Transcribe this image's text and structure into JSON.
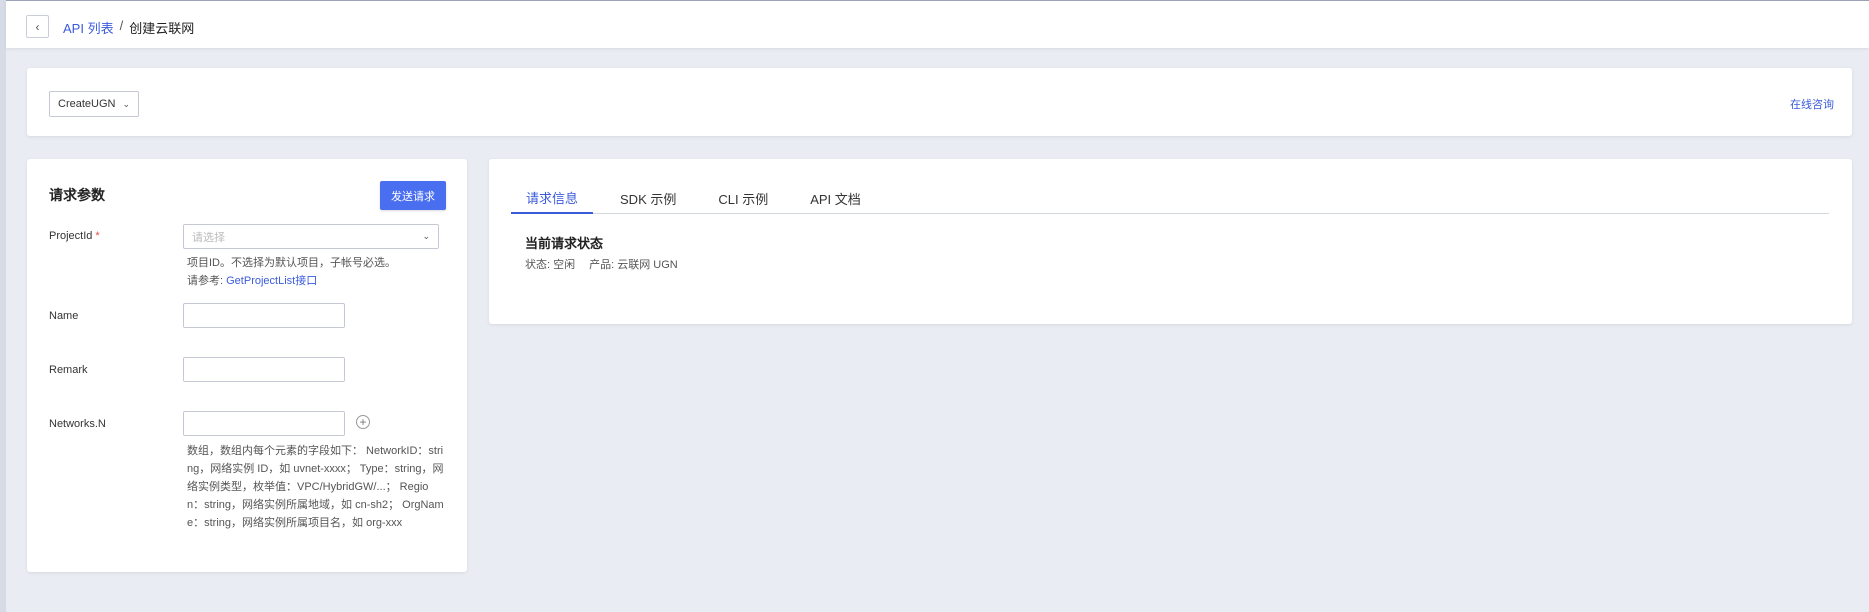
{
  "breadcrumb": {
    "back_icon": "chevron-left-icon",
    "parent": "API 列表",
    "separator": "/",
    "current": "创建云联网"
  },
  "action_bar": {
    "selected_action": "CreateUGN",
    "online_consult": "在线咨询"
  },
  "params": {
    "title": "请求参数",
    "send_button": "发送请求",
    "project_id": {
      "label": "ProjectId",
      "required_mark": "*",
      "placeholder": "请选择",
      "help_line1": "项目ID。不选择为默认项目，子帐号必选。",
      "help_line2_prefix": "请参考:",
      "help_link": "GetProjectList接口"
    },
    "name": {
      "label": "Name",
      "value": ""
    },
    "remark": {
      "label": "Remark",
      "value": ""
    },
    "networks": {
      "label": "Networks.N",
      "value": "",
      "add_icon": "plus-circle-icon",
      "help": "数组，数组内每个元素的字段如下： NetworkID：string，网络实例 ID，如 uvnet-xxxx； Type：string，网络实例类型，枚举值：VPC/HybridGW/...； Region：string，网络实例所属地域，如 cn-sh2； OrgName：string，网络实例所属项目名，如 org-xxx"
    }
  },
  "info": {
    "tabs": [
      {
        "label": "请求信息",
        "active": true
      },
      {
        "label": "SDK 示例",
        "active": false
      },
      {
        "label": "CLI 示例",
        "active": false
      },
      {
        "label": "API 文档",
        "active": false
      }
    ],
    "status_title": "当前请求状态",
    "status_text": "状态: 空闲",
    "product_text": "产品: 云联网 UGN"
  },
  "colors": {
    "accent": "#3b5bdb",
    "button": "#4a6ef0",
    "background": "#e9ecf3",
    "required": "#e74c3c"
  }
}
